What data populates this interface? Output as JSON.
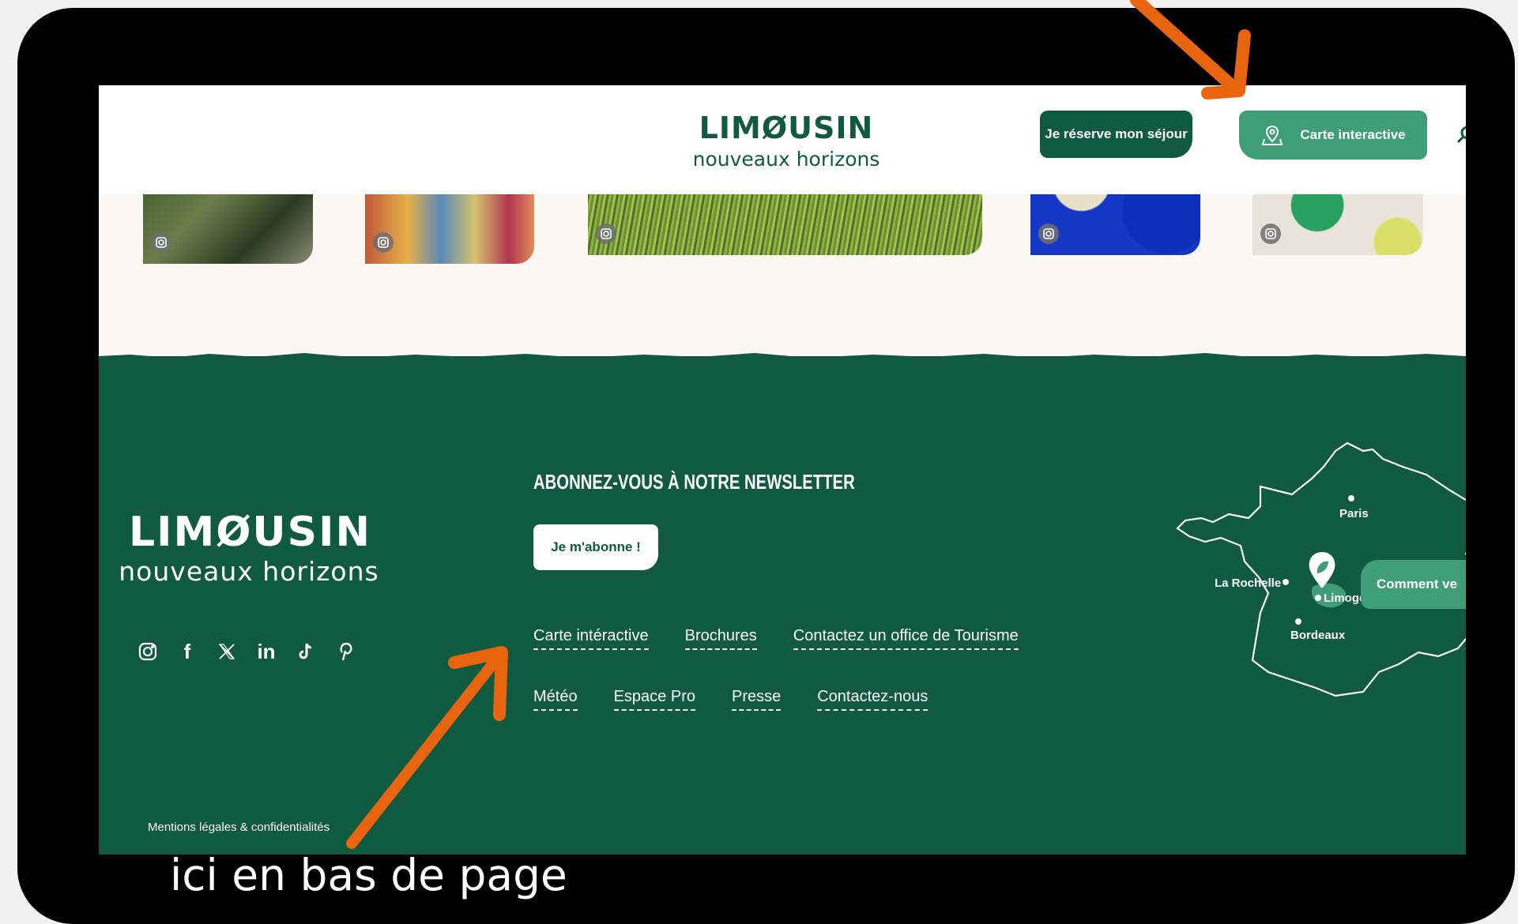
{
  "header": {
    "logo_main": "LIMØUSIN",
    "logo_sub": "nouveaux horizons",
    "reserve_label": "Je réserve mon séjour",
    "carte_label": "Carte interactive"
  },
  "footer": {
    "logo_main": "LIMØUSIN",
    "logo_sub": "nouveaux horizons",
    "newsletter_title": "ABONNEZ-VOUS À NOTRE NEWSLETTER",
    "subscribe_label": "Je m'abonne !",
    "links_row1": [
      "Carte intéractive",
      "Brochures",
      "Contactez un office de Tourisme"
    ],
    "links_row2": [
      "Météo",
      "Espace Pro",
      "Presse",
      "Contactez-nous"
    ],
    "mentions": "Mentions légales & confidentialités",
    "comment_label": "Comment ve",
    "map_cities": [
      "Paris",
      "La Rochelle",
      "Limoges",
      "Bordeaux"
    ],
    "socials": [
      "instagram-icon",
      "facebook-icon",
      "x-icon",
      "linkedin-icon",
      "tiktok-icon",
      "pinterest-icon"
    ]
  },
  "caption": "ici en bas de page",
  "colors": {
    "brand_green": "#0f5a40",
    "accent_green": "#3f9e79",
    "arrow_orange": "#e8640f"
  }
}
